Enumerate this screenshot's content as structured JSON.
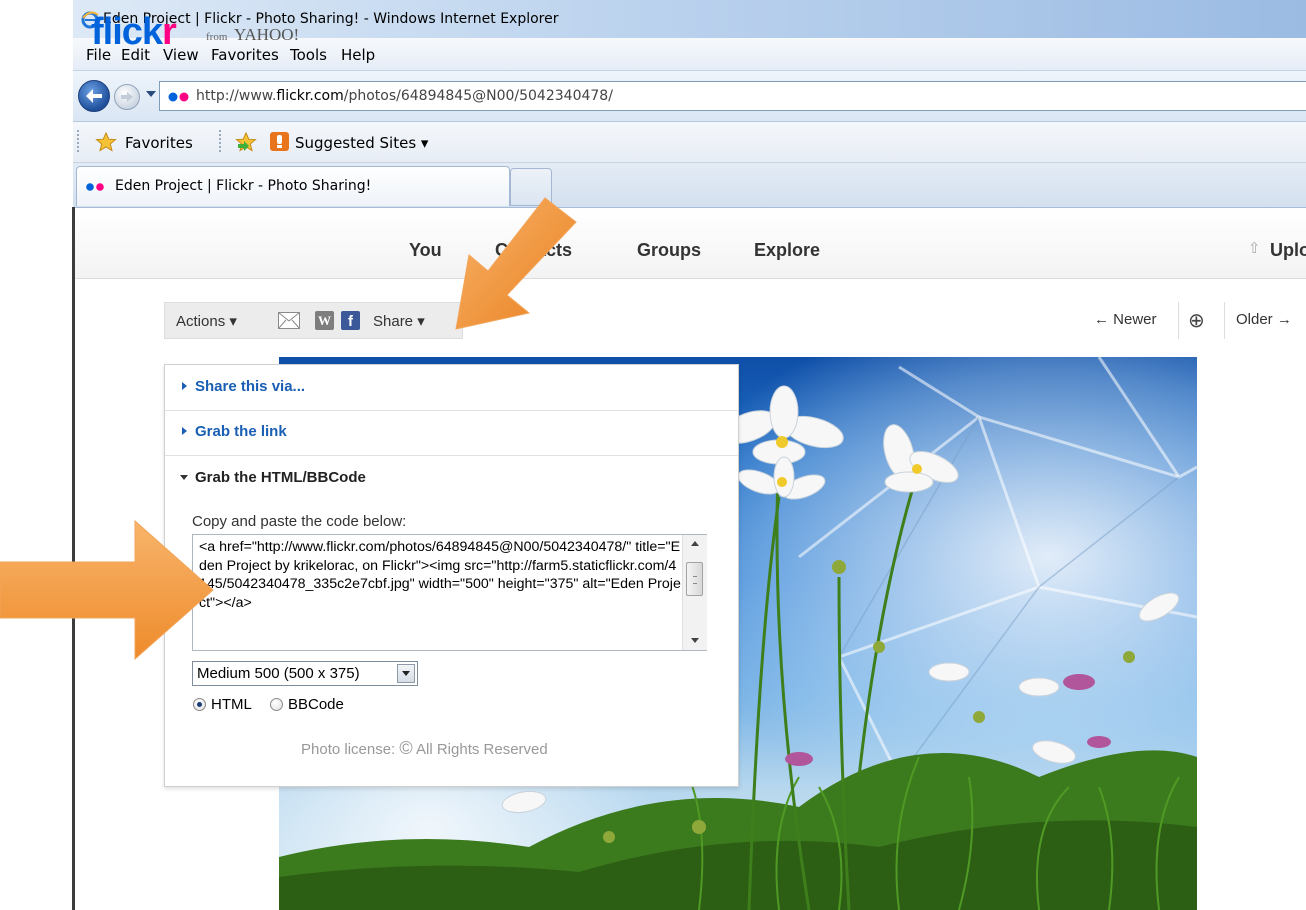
{
  "browser": {
    "window_title": "Eden Project | Flickr - Photo Sharing! - Windows Internet Explorer",
    "menu": [
      "File",
      "Edit",
      "View",
      "Favorites",
      "Tools",
      "Help"
    ],
    "address": {
      "prefix": "http://www.",
      "domain": "flickr.com",
      "path": "/photos/64894845@N00/5042340478/"
    },
    "favorites_label": "Favorites",
    "suggested_sites_label": "Suggested Sites ▾",
    "tab_title": "Eden Project | Flickr - Photo Sharing!"
  },
  "flickr": {
    "logo": {
      "main": "flick",
      "accent": "r",
      "from": "from",
      "yahoo": "YAHOO!"
    },
    "nav": [
      "You",
      "Contacts",
      "Groups",
      "Explore"
    ],
    "upload_label": "Uploa",
    "toolbar": {
      "actions_label": "Actions ▾",
      "share_label": "Share ▾",
      "wordpress_glyph": "W",
      "facebook_glyph": "f"
    },
    "pager": {
      "newer_label": "← Newer",
      "zoom_glyph": "⊕",
      "older_label": "Older →"
    },
    "share_panel": {
      "share_via_label": "Share this via...",
      "grab_link_label": "Grab the link",
      "grab_html_label": "Grab the HTML/BBCode",
      "copy_label": "Copy and paste the code below:",
      "code": "<a href=\"http://www.flickr.com/photos/64894845@N00/5042340478/\" title=\"Eden Project by krikelorac, on Flickr\"><img src=\"http://farm5.staticflickr.com/4145/5042340478_335c2e7cbf.jpg\" width=\"500\" height=\"375\" alt=\"Eden Project\"></a>",
      "size_select_value": "Medium 500 (500 x 375)",
      "format_options": {
        "html": "HTML",
        "bbcode": "BBCode",
        "selected": "HTML"
      },
      "license_prefix": "Photo license:",
      "license_symbol": "©",
      "license_text": "All Rights Reserved"
    }
  },
  "colors": {
    "flickr_blue": "#0063dc",
    "flickr_pink": "#ff0084",
    "link_blue": "#1a5fb4",
    "annotation_orange": "#f39a3c"
  },
  "icons": [
    "ie-logo-icon",
    "back-arrow-icon",
    "forward-arrow-icon",
    "flickr-favicon-icon",
    "favorites-star-icon",
    "add-favorite-icon",
    "suggested-sites-icon",
    "upload-arrow-icon",
    "mail-icon",
    "wordpress-icon",
    "facebook-icon",
    "zoom-icon",
    "copyright-icon"
  ]
}
